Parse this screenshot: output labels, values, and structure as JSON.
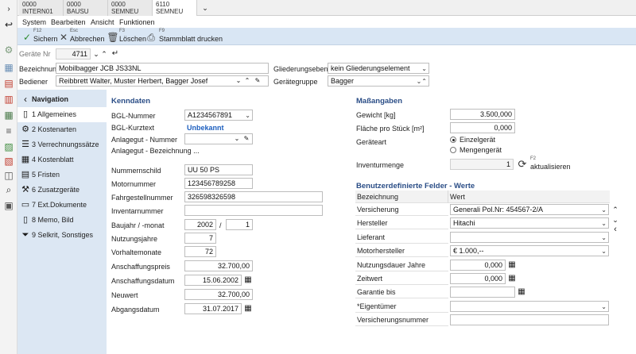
{
  "tabs": [
    {
      "code": "0000",
      "name": "INTERN01"
    },
    {
      "code": "0000",
      "name": "BAUSU"
    },
    {
      "code": "0000",
      "name": "SEMNEU"
    },
    {
      "code": "6110",
      "name": "SEMNEU"
    }
  ],
  "menu": [
    "System",
    "Bearbeiten",
    "Ansicht",
    "Funktionen"
  ],
  "toolbar": {
    "save": {
      "key": "F12",
      "label": "Sichern"
    },
    "cancel": {
      "key": "Esc",
      "label": "Abbrechen"
    },
    "delete": {
      "key": "F3",
      "label": "Löschen"
    },
    "print": {
      "key": "F9",
      "label": "Stammblatt drucken"
    }
  },
  "header": {
    "geraete_nr_label": "Geräte Nr",
    "geraete_nr": "4711",
    "bezeichnung_label": "Bezeichnung",
    "bezeichnung": "Mobilbagger JCB JS33NL",
    "bediener_label": "Bediener",
    "bediener": "Reibbrett Walter, Muster Herbert, Bagger Josef",
    "gliederungsebene_label": "Gliederungsebene",
    "gliederungsebene": "kein Gliederungselement",
    "geraetegruppe_label": "Gerätegruppe",
    "geraetegruppe": "Bagger"
  },
  "nav": {
    "title": "Navigation",
    "items": [
      "1 Allgemeines",
      "2 Kostenarten",
      "3 Verrechnungssätze",
      "4 Kostenblatt",
      "5 Fristen",
      "6 Zusatzgeräte",
      "7 Ext.Dokumente",
      "8 Memo, Bild",
      "9 Selkrit, Sonstiges"
    ]
  },
  "kenndaten": {
    "title": "Kenndaten",
    "bgl_nummer_label": "BGL-Nummer",
    "bgl_nummer": "A1234567891",
    "bgl_kurztext_label": "BGL-Kurztext",
    "bgl_kurztext": "Unbekannt",
    "anlagegut_nummer_label": "Anlagegut - Nummer",
    "anlagegut_bezeichnung_label": "Anlagegut - Bezeichnung ...",
    "nummernschild_label": "Nummernschild",
    "nummernschild": "UU 50 PS",
    "motornummer_label": "Motornummer",
    "motornummer": "123456789258",
    "fahrgestellnummer_label": "Fahrgestellnummer",
    "fahrgestellnummer": "326598326598",
    "inventarnummer_label": "Inventarnummer",
    "inventarnummer": "",
    "baujahr_label": "Baujahr / -monat",
    "baujahr": "2002",
    "baujahr_sep": "/",
    "baumonat": "1",
    "nutzungsjahre_label": "Nutzungsjahre",
    "nutzungsjahre": "7",
    "vorhaltemonate_label": "Vorhaltemonate",
    "vorhaltemonate": "72",
    "anschaffungspreis_label": "Anschaffungspreis",
    "anschaffungspreis": "32.700,00",
    "anschaffungsdatum_label": "Anschaffungsdatum",
    "anschaffungsdatum": "15.06.2002",
    "neuwert_label": "Neuwert",
    "neuwert": "32.700,00",
    "abgangsdatum_label": "Abgangsdatum",
    "abgangsdatum": "31.07.2017"
  },
  "massangaben": {
    "title": "Maßangaben",
    "gewicht_label": "Gewicht [kg]",
    "gewicht": "3.500,000",
    "flaeche_label": "Fläche pro Stück [m²]",
    "flaeche": "0,000",
    "geraeteart_label": "Geräteart",
    "einzelgeraet": "Einzelgerät",
    "mengengeraet": "Mengengerät",
    "inventurmenge_label": "Inventurmenge",
    "inventurmenge": "1",
    "refresh_key": "F2",
    "refresh_label": "aktualisieren"
  },
  "custom_fields": {
    "title": "Benutzerdefinierte Felder - Werte",
    "col_name": "Bezeichnung",
    "col_value": "Wert",
    "rows": [
      {
        "name": "Versicherung",
        "value": "Generali Pol.Nr: 454567-2/A"
      },
      {
        "name": "Hersteller",
        "value": "Hitachi"
      },
      {
        "name": "Lieferant",
        "value": ""
      },
      {
        "name": "Motorhersteller",
        "value": "€ 1.000,--"
      },
      {
        "name": "Nutzungsdauer Jahre",
        "value": "0,000"
      },
      {
        "name": "Zeitwert",
        "value": "0,000"
      },
      {
        "name": "Garantie bis",
        "value": ""
      },
      {
        "name": "*Eigentümer",
        "value": ""
      },
      {
        "name": "Versicherungsnummer",
        "value": ""
      }
    ]
  },
  "colors": {
    "toolbar": "#d9e6f4",
    "nav": "#dce7f3",
    "header": "#2a4d86",
    "link": "#1d5fbf"
  }
}
